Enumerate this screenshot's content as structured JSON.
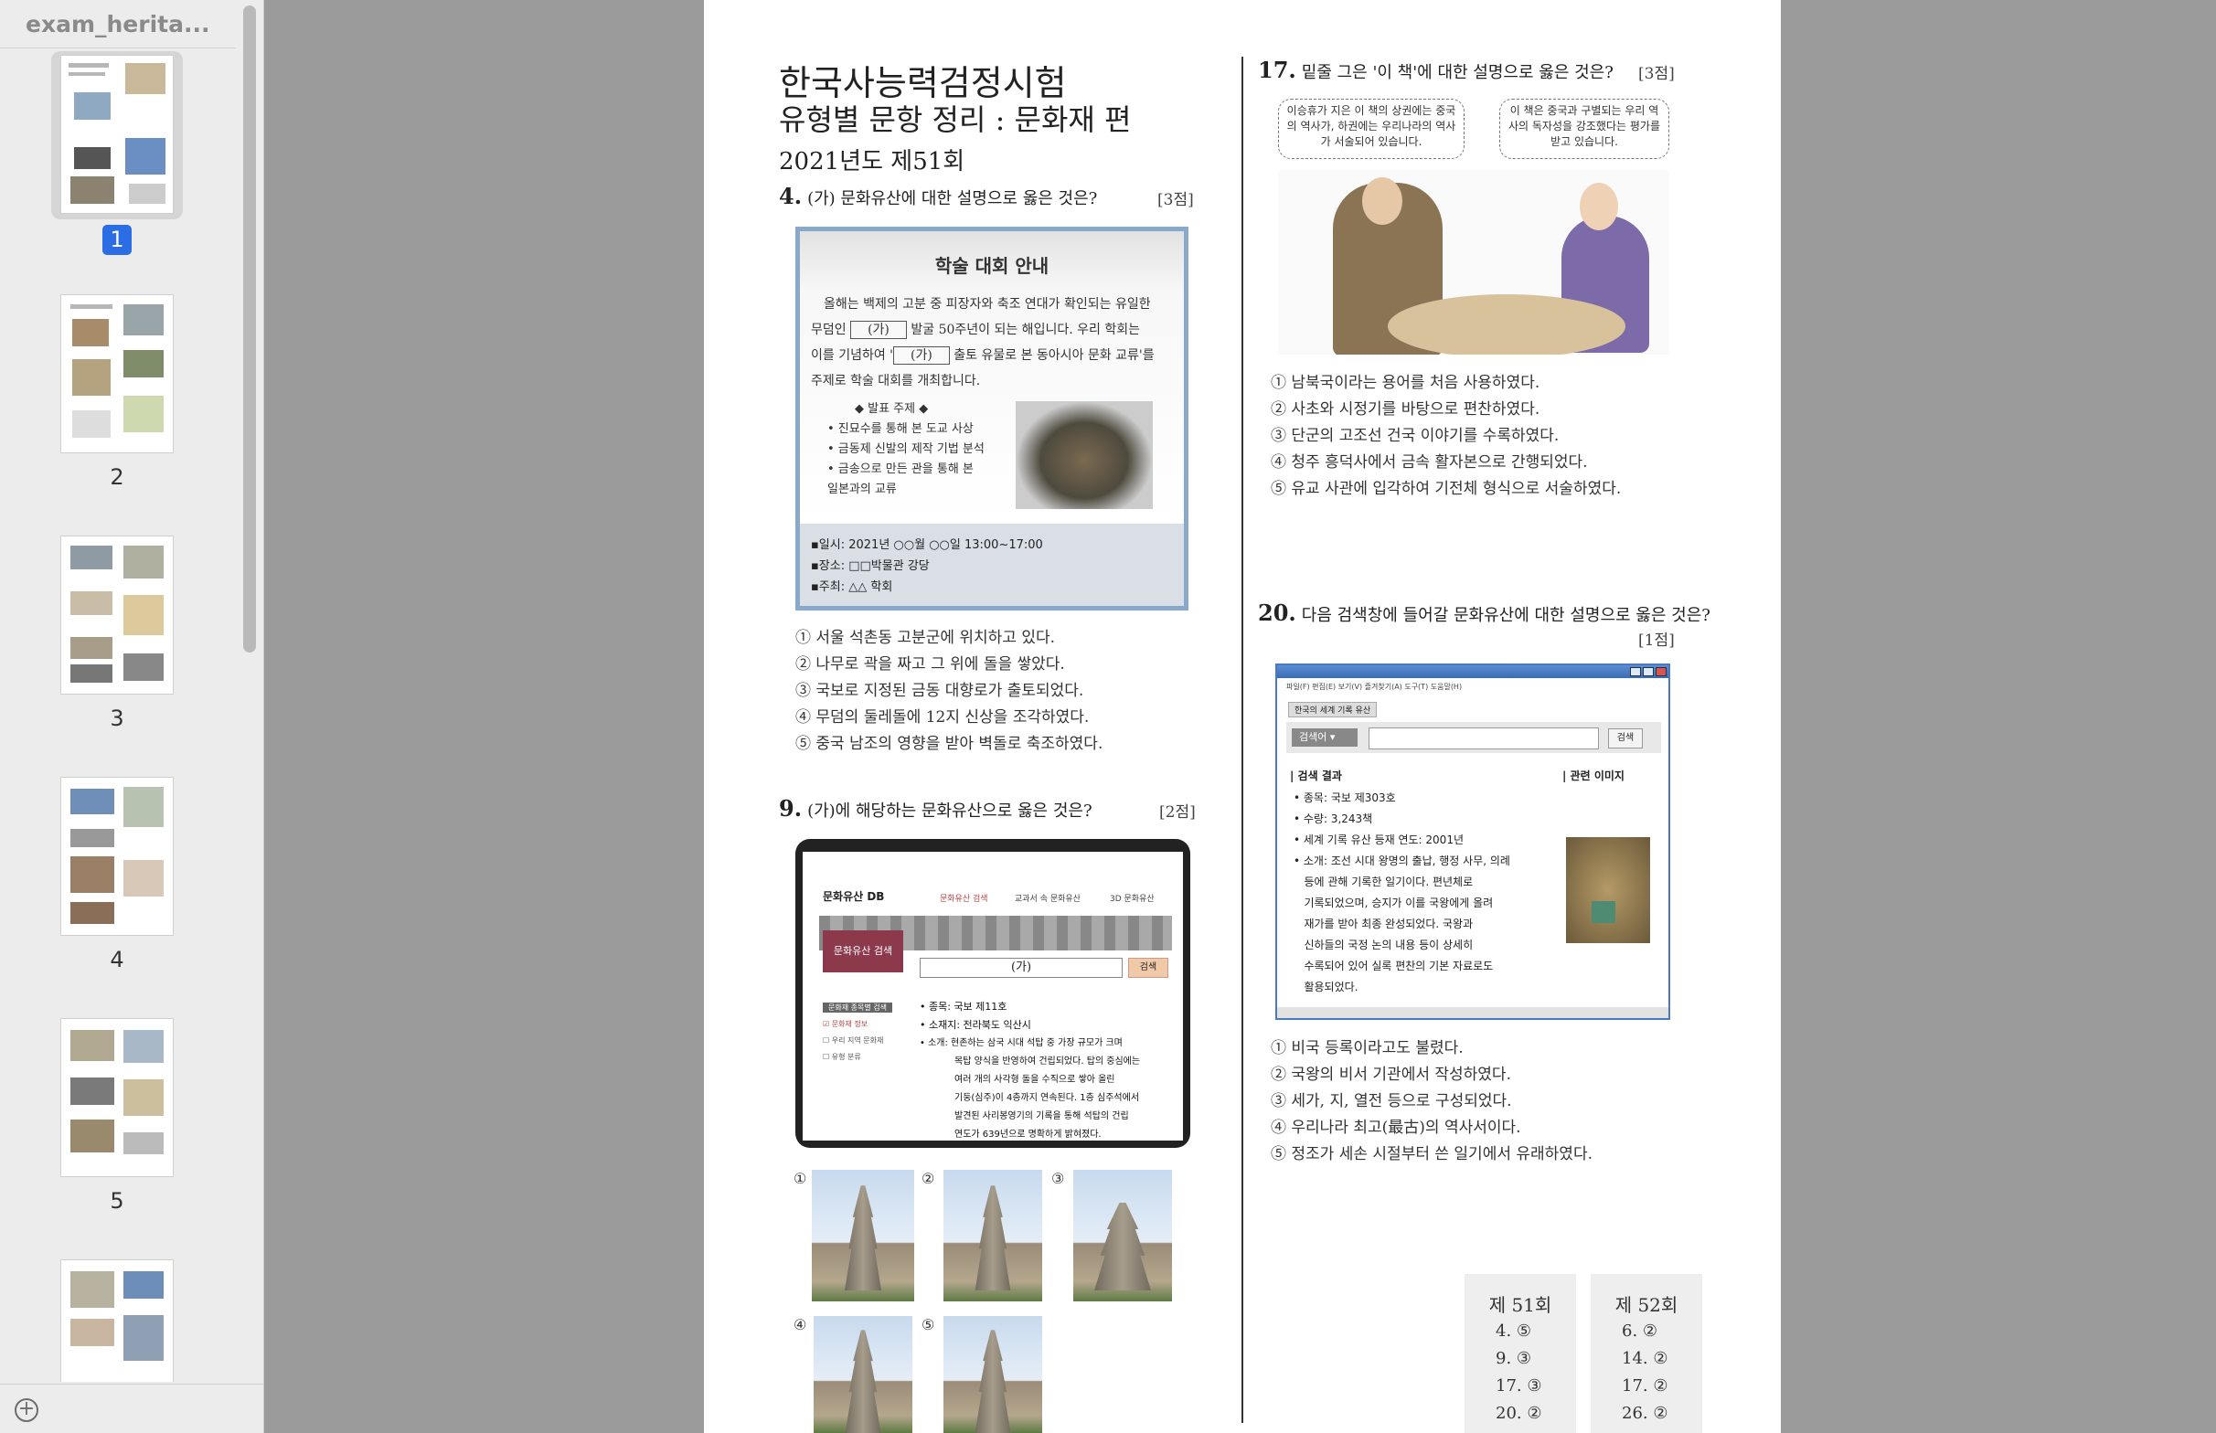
{
  "sidebar": {
    "doc_title": "exam_herita...",
    "thumbnails": [
      {
        "label": "1",
        "selected": true
      },
      {
        "label": "2",
        "selected": false
      },
      {
        "label": "3",
        "selected": false
      },
      {
        "label": "4",
        "selected": false
      },
      {
        "label": "5",
        "selected": false
      },
      {
        "label": "",
        "selected": false
      }
    ],
    "add_icon": "plus-circle-icon"
  },
  "page": {
    "title": "한국사능력검정시험",
    "subtitle": "유형별 문항 정리 : 문화재 편",
    "year": "2021년도 제51회",
    "q4": {
      "num": "4.",
      "text": "(가) 문화유산에 대한 설명으로 옳은 것은?",
      "points": "[3점]",
      "poster": {
        "title": "학술 대회 안내",
        "line1_a": "올해는 백제의 고분 중 피장자와 축조 연대가 확인되는 유일한",
        "line2_a": "무덤인",
        "blank": "(가)",
        "line2_b": "발굴 50주년이 되는 해입니다. 우리 학회는",
        "line3_a": "이를 기념하여 '",
        "line3_b": "출토 유물로 본 동아시아 문화 교류'를",
        "line4": "주제로 학술 대회를 개최합니다.",
        "topics_head": "◆ 발표 주제 ◆",
        "topics": [
          "• 진묘수를 통해 본 도교 사상",
          "• 금동제 신발의 제작 기법 분석",
          "• 금송으로 만든 관을 통해 본",
          "   일본과의 교류"
        ],
        "date": "▪일시: 2021년 ○○월 ○○일 13:00~17:00",
        "place": "▪장소: □□박물관 강당",
        "host": "▪주최: △△ 학회"
      },
      "options": [
        "① 서울 석촌동 고분군에 위치하고 있다.",
        "② 나무로 곽을 짜고 그 위에 돌을 쌓았다.",
        "③ 국보로 지정된 금동 대향로가 출토되었다.",
        "④ 무덤의 둘레돌에 12지 신상을 조각하였다.",
        "⑤ 중국 남조의 영향을 받아 벽돌로 축조하였다."
      ]
    },
    "q9": {
      "num": "9.",
      "text": "(가)에 해당하는 문화유산으로 옳은 것은?",
      "points": "[2점]",
      "tablet": {
        "brand": "문화유산 DB",
        "nav": [
          "문화유산 검색",
          "교과서 속 문화유산",
          "3D 문화유산"
        ],
        "side_button": "문화유산 검색",
        "input_value": "(가)",
        "search_btn": "검색",
        "side_head": "문화재 종목별 검색",
        "side_items": [
          "☑ 문화재 정보",
          "☐ 우리 지역 문화재",
          "☐ 유형 분류"
        ],
        "info": [
          "• 종목: 국보 제11호",
          "• 소재지: 전라북도 익산시",
          "• 소개: 현존하는 삼국 시대 석탑 중 가장 규모가 크며",
          "목탑 양식을 반영하여 건립되었다. 탑의 중심에는",
          "여러 개의 사각형 돌을 수직으로 쌓아 올린",
          "기둥(심주)이 4층까지 연속된다. 1층 심주석에서",
          "발견된 사리봉영기의 기록을 통해 석탑의 건립",
          "연도가 639년으로 명확하게 밝혀졌다."
        ]
      },
      "photo_labels": [
        "①",
        "②",
        "③",
        "④",
        "⑤"
      ]
    },
    "q17": {
      "num": "17.",
      "text": "밑줄 그은 '이 책'에 대한 설명으로 옳은 것은?",
      "points": "[3점]",
      "bubble_left": "이승휴가 지은 이 책의 상권에는 중국의 역사가, 하권에는 우리나라의 역사가 서술되어 있습니다.",
      "bubble_right": "이 책은 중국과 구별되는 우리 역사의 독자성을 강조했다는 평가를 받고 있습니다.",
      "options": [
        "① 남북국이라는 용어를 처음 사용하였다.",
        "② 사초와 시정기를 바탕으로 편찬하였다.",
        "③ 단군의 고조선 건국 이야기를 수록하였다.",
        "④ 청주 흥덕사에서 금속 활자본으로 간행되었다.",
        "⑤ 유교 사관에 입각하여 기전체 형식으로 서술하였다."
      ]
    },
    "q20": {
      "num": "20.",
      "text": "다음 검색창에 들어갈 문화유산에 대한 설명으로 옳은 것은?",
      "points": "[1점]",
      "window": {
        "menu": "파일(F)  편집(E)  보기(V)  즐겨찾기(A)  도구(T)  도움말(H)",
        "tab": "한국의 세계 기록 유산",
        "select": "검색어",
        "search_btn": "검색",
        "results_head": "| 검색 결과",
        "images_head": "| 관련 이미지",
        "info": [
          "• 종목: 국보 제303호",
          "• 수량: 3,243책",
          "• 세계 기록 유산 등재 연도: 2001년",
          "• 소개: 조선 시대 왕명의 출납, 행정 사무, 의례",
          "   등에 관해 기록한 일기이다. 편년체로",
          "   기록되었으며, 승지가 이를 국왕에게 올려",
          "   재가를 받아 최종 완성되었다. 국왕과",
          "   신하들의 국정 논의 내용 등이 상세히",
          "   수록되어 있어 실록 편찬의 기본 자료로도",
          "   활용되었다."
        ]
      },
      "options": [
        "① 비국 등록이라고도 불렸다.",
        "② 국왕의 비서 기관에서 작성하였다.",
        "③ 세가, 지, 열전 등으로 구성되었다.",
        "④ 우리나라 최고(最古)의 역사서이다.",
        "⑤ 정조가 세손 시절부터 쓴 일기에서 유래하였다."
      ]
    },
    "answers": [
      {
        "head": "제 51회",
        "rows": [
          "4.   ⑤",
          "9.   ③",
          "17.   ③",
          "20.   ②"
        ]
      },
      {
        "head": "제 52회",
        "rows": [
          "6.   ②",
          "14.   ②",
          "17.   ②",
          "26.   ②"
        ]
      }
    ]
  }
}
